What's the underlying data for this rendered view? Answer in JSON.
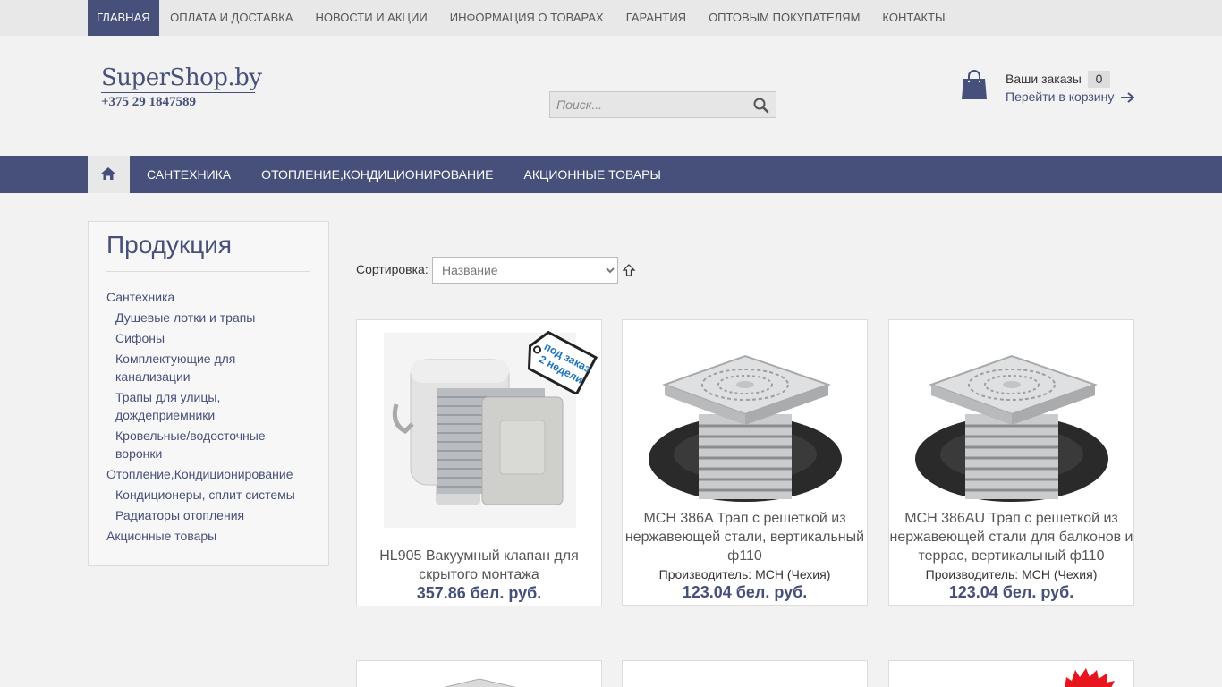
{
  "top_nav": {
    "items": [
      {
        "label": "Главная",
        "active": true
      },
      {
        "label": "Оплата и доставка"
      },
      {
        "label": "Новости и акции"
      },
      {
        "label": "Информация о товарах"
      },
      {
        "label": "Гарантия"
      },
      {
        "label": "Оптовым покупателям"
      },
      {
        "label": "Контакты"
      }
    ]
  },
  "logo": {
    "name": "SuperShop.by",
    "phone": "+375 29 1847589"
  },
  "search": {
    "placeholder": "Поиск..."
  },
  "cart": {
    "title": "Ваши заказы",
    "count": "0",
    "link_label": "Перейти в корзину"
  },
  "category_nav": {
    "items": [
      {
        "label": "Сантехника"
      },
      {
        "label": "Отопление,Кондиционирование"
      },
      {
        "label": "Акционные товары"
      }
    ]
  },
  "sidebar": {
    "title": "Продукция",
    "items": [
      {
        "label": "Сантехника",
        "level": 0
      },
      {
        "label": "Душевые лотки и трапы",
        "level": 1
      },
      {
        "label": "Сифоны",
        "level": 1
      },
      {
        "label": "Комплектующие для канализации",
        "level": 1
      },
      {
        "label": "Трапы для улицы, дождеприемники",
        "level": 1
      },
      {
        "label": "Кровельные/водосточные воронки",
        "level": 1
      },
      {
        "label": "Отопление,Кондиционирование",
        "level": 0
      },
      {
        "label": "Кондиционеры, сплит системы",
        "level": 1
      },
      {
        "label": "Радиаторы отопления",
        "level": 1
      },
      {
        "label": "Акционные товары",
        "level": 0
      }
    ]
  },
  "sort": {
    "label": "Сортировка:",
    "selected": "Название"
  },
  "badges": {
    "order_line1": "под заказ",
    "order_line2": "2 недели"
  },
  "products": [
    {
      "title": "HL905 Вакуумный клапан для скрытого монтажа",
      "maker": "",
      "price": "357.86 бел. руб."
    },
    {
      "title": "MCH 386A Трап с решеткой из нержавеющей стали, вертикальный ф110",
      "maker": "Производитель: MCH (Чехия)",
      "price": "123.04 бел. руб."
    },
    {
      "title": "MCH 386AU Трап с решеткой из нержавеющей стали для балконов и террас, вертикальный ф110",
      "maker": "Производитель: MCH (Чехия)",
      "price": "123.04 бел. руб."
    }
  ],
  "colors": {
    "brand": "#46507a",
    "background": "#f2f2f2",
    "badge_blue": "#1e73be",
    "badge_red": "#e8141e"
  },
  "icons": {
    "home": "home-icon",
    "search": "search-icon",
    "cart": "shopping-bag-icon",
    "arrow": "arrow-right-icon",
    "sort_dir": "arrow-up-icon"
  }
}
